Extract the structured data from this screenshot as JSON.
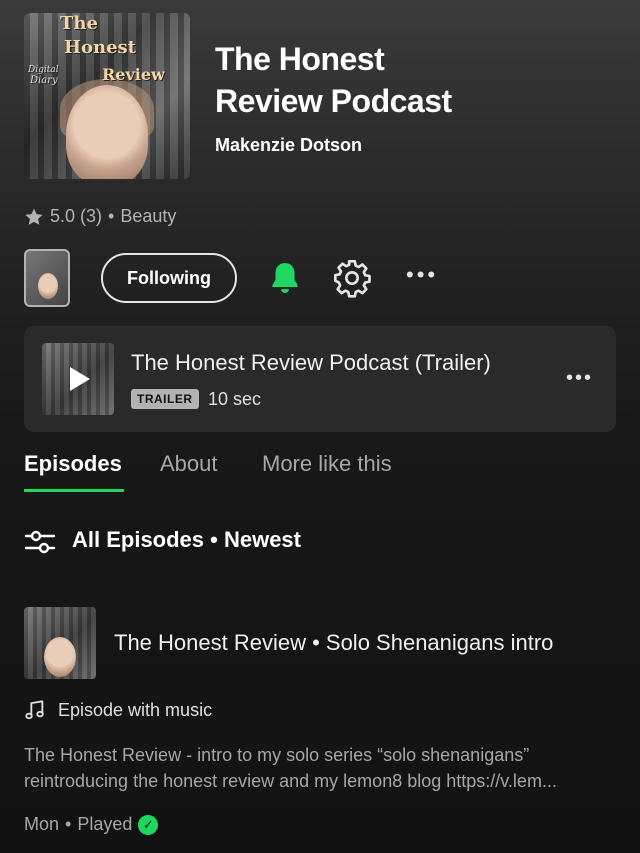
{
  "podcast": {
    "title_line1": "The Honest",
    "title_line2": "Review Podcast",
    "author": "Makenzie Dotson",
    "rating": "5.0 (3)",
    "separator": "•",
    "category": "Beauty",
    "cover_text": {
      "word1": "The",
      "word2": "Honest",
      "word3": "Review",
      "script1": "Digital",
      "script2": "Diary"
    }
  },
  "actions": {
    "following_label": "Following",
    "bell_state": "on",
    "more_label": "•••"
  },
  "trailer": {
    "title": "The Honest Review Podcast  (Trailer)",
    "badge": "TRAILER",
    "duration": "10 sec",
    "more_label": "•••"
  },
  "tabs": [
    {
      "label": "Episodes",
      "active": true
    },
    {
      "label": "About",
      "active": false
    },
    {
      "label": "More like this",
      "active": false
    }
  ],
  "filter": {
    "label": "All Episodes • Newest"
  },
  "episode": {
    "title": "The Honest Review • Solo Shenanigans intro",
    "music_label": "Episode with music",
    "desc_line1": "The Honest Review - intro to my solo series “solo shenanigans”",
    "desc_line2": "reintroducing the honest review and my lemon8 blog https://v.lem...",
    "day": "Mon",
    "separator": "•",
    "status": "Played"
  },
  "colors": {
    "accent": "#1ed760",
    "background": "#121212",
    "card": "#2a2a2a",
    "muted_text": "#a7a7a7"
  }
}
